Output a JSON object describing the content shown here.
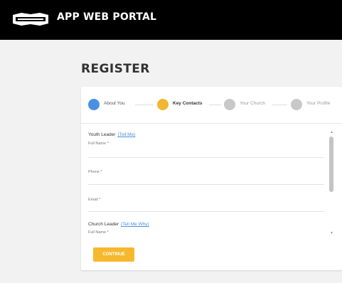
{
  "header": {
    "app_title": "APP WEB PORTAL",
    "logo_icon": "crest-logo-icon",
    "background": "#000000"
  },
  "page": {
    "title": "REGISTER"
  },
  "steps": [
    {
      "label": "About You",
      "state": "done",
      "color": "#4a90e2"
    },
    {
      "label": "Key Contacts",
      "state": "current",
      "color": "#f2b632"
    },
    {
      "label": "Your Church",
      "state": "pending",
      "color": "#c8c8c8"
    },
    {
      "label": "Your Profile",
      "state": "pending",
      "color": "#c8c8c8"
    }
  ],
  "form": {
    "youth_leader": {
      "title": "Youth Leader",
      "link": "(Tell Me)",
      "full_name_label": "Full Name *",
      "phone_label": "Phone *",
      "email_label": "Email *"
    },
    "church_leader": {
      "title": "Church Leader",
      "link": "(Tell Me Why)",
      "full_name_label": "Full Name *"
    }
  },
  "buttons": {
    "continue": "CONTINUE"
  },
  "colors": {
    "accent": "#f5b82e",
    "link": "#4a90e2"
  }
}
